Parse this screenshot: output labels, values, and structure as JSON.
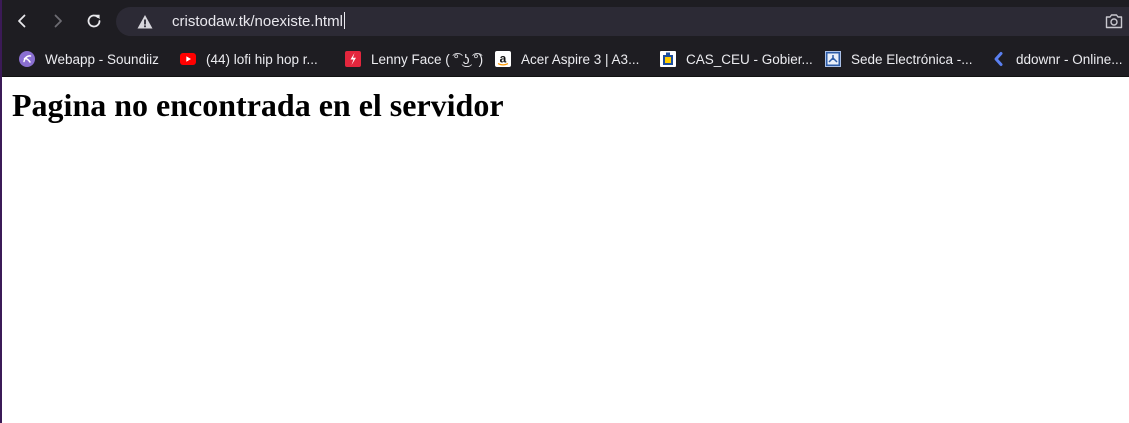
{
  "toolbar": {
    "url": "cristodaw.tk/noexiste.html"
  },
  "bookmarks": [
    {
      "label": "Webapp - Soundiiz",
      "icon": "soundiiz-icon"
    },
    {
      "label": "(44) lofi hip hop r...",
      "icon": "youtube-icon"
    },
    {
      "label": "Lenny Face ( ͡° ͜ʖ ͡°)",
      "icon": "lenny-face-icon"
    },
    {
      "label": "Acer Aspire 3 | A3...",
      "icon": "amazon-icon"
    },
    {
      "label": "CAS_CEU - Gobier...",
      "icon": "canarias-icon"
    },
    {
      "label": "Sede Electrónica -...",
      "icon": "sede-electronica-icon"
    },
    {
      "label": "ddownr - Online...",
      "icon": "ddownr-icon"
    }
  ],
  "page": {
    "heading": "Pagina no encontrada en el servidor"
  },
  "colors": {
    "toolbar_bg": "#1e1d22",
    "omnibox_bg": "#2c2a35",
    "youtube_red": "#ff0000",
    "soundiiz_purple": "#8a6fd1"
  }
}
